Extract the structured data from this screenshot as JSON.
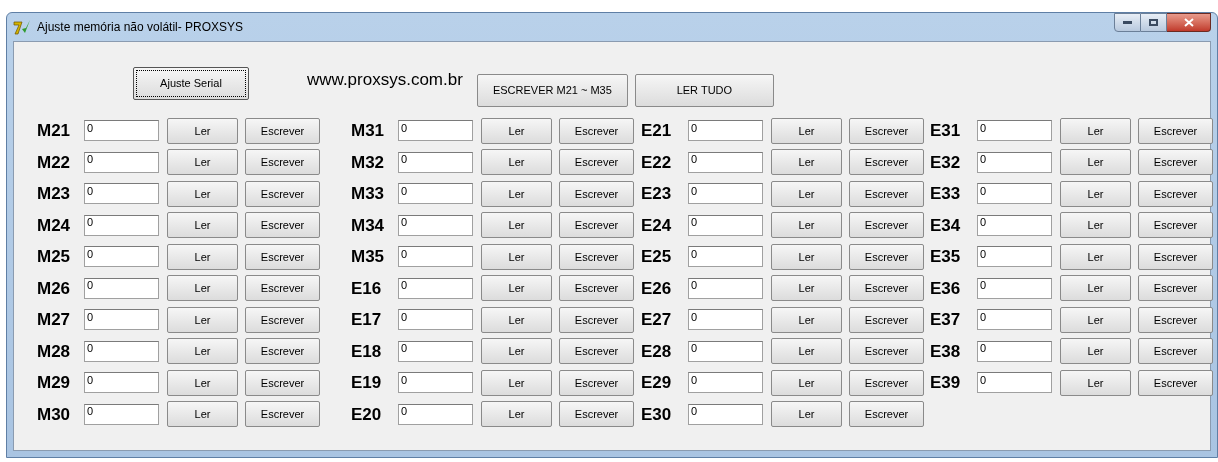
{
  "window": {
    "title": "Ajuste memória não volátil- PROXSYS"
  },
  "toolbar": {
    "serial_button": "Ajuste Serial",
    "website": "www.proxsys.com.br",
    "write_range_button": "ESCREVER M21 ~ M35",
    "read_all_button": "LER TUDO"
  },
  "columns": [
    [
      {
        "label": "M21",
        "value": "0",
        "read": "Ler",
        "write": "Escrever"
      },
      {
        "label": "M22",
        "value": "0",
        "read": "Ler",
        "write": "Escrever"
      },
      {
        "label": "M23",
        "value": "0",
        "read": "Ler",
        "write": "Escrever"
      },
      {
        "label": "M24",
        "value": "0",
        "read": "Ler",
        "write": "Escrever"
      },
      {
        "label": "M25",
        "value": "0",
        "read": "Ler",
        "write": "Escrever"
      },
      {
        "label": "M26",
        "value": "0",
        "read": "Ler",
        "write": "Escrever"
      },
      {
        "label": "M27",
        "value": "0",
        "read": "Ler",
        "write": "Escrever"
      },
      {
        "label": "M28",
        "value": "0",
        "read": "Ler",
        "write": "Escrever"
      },
      {
        "label": "M29",
        "value": "0",
        "read": "Ler",
        "write": "Escrever"
      },
      {
        "label": "M30",
        "value": "0",
        "read": "Ler",
        "write": "Escrever"
      }
    ],
    [
      {
        "label": "M31",
        "value": "0",
        "read": "Ler",
        "write": "Escrever"
      },
      {
        "label": "M32",
        "value": "0",
        "read": "Ler",
        "write": "Escrever"
      },
      {
        "label": "M33",
        "value": "0",
        "read": "Ler",
        "write": "Escrever"
      },
      {
        "label": "M34",
        "value": "0",
        "read": "Ler",
        "write": "Escrever"
      },
      {
        "label": "M35",
        "value": "0",
        "read": "Ler",
        "write": "Escrever"
      },
      {
        "label": "E16",
        "value": "0",
        "read": "Ler",
        "write": "Escrever"
      },
      {
        "label": "E17",
        "value": "0",
        "read": "Ler",
        "write": "Escrever"
      },
      {
        "label": "E18",
        "value": "0",
        "read": "Ler",
        "write": "Escrever"
      },
      {
        "label": "E19",
        "value": "0",
        "read": "Ler",
        "write": "Escrever"
      },
      {
        "label": "E20",
        "value": "0",
        "read": "Ler",
        "write": "Escrever"
      }
    ],
    [
      {
        "label": "E21",
        "value": "0",
        "read": "Ler",
        "write": "Escrever"
      },
      {
        "label": "E22",
        "value": "0",
        "read": "Ler",
        "write": "Escrever"
      },
      {
        "label": "E23",
        "value": "0",
        "read": "Ler",
        "write": "Escrever"
      },
      {
        "label": "E24",
        "value": "0",
        "read": "Ler",
        "write": "Escrever"
      },
      {
        "label": "E25",
        "value": "0",
        "read": "Ler",
        "write": "Escrever"
      },
      {
        "label": "E26",
        "value": "0",
        "read": "Ler",
        "write": "Escrever"
      },
      {
        "label": "E27",
        "value": "0",
        "read": "Ler",
        "write": "Escrever"
      },
      {
        "label": "E28",
        "value": "0",
        "read": "Ler",
        "write": "Escrever"
      },
      {
        "label": "E29",
        "value": "0",
        "read": "Ler",
        "write": "Escrever"
      },
      {
        "label": "E30",
        "value": "0",
        "read": "Ler",
        "write": "Escrever"
      }
    ],
    [
      {
        "label": "E31",
        "value": "0",
        "read": "Ler",
        "write": "Escrever"
      },
      {
        "label": "E32",
        "value": "0",
        "read": "Ler",
        "write": "Escrever"
      },
      {
        "label": "E33",
        "value": "0",
        "read": "Ler",
        "write": "Escrever"
      },
      {
        "label": "E34",
        "value": "0",
        "read": "Ler",
        "write": "Escrever"
      },
      {
        "label": "E35",
        "value": "0",
        "read": "Ler",
        "write": "Escrever"
      },
      {
        "label": "E36",
        "value": "0",
        "read": "Ler",
        "write": "Escrever"
      },
      {
        "label": "E37",
        "value": "0",
        "read": "Ler",
        "write": "Escrever"
      },
      {
        "label": "E38",
        "value": "0",
        "read": "Ler",
        "write": "Escrever"
      },
      {
        "label": "E39",
        "value": "0",
        "read": "Ler",
        "write": "Escrever"
      }
    ]
  ]
}
